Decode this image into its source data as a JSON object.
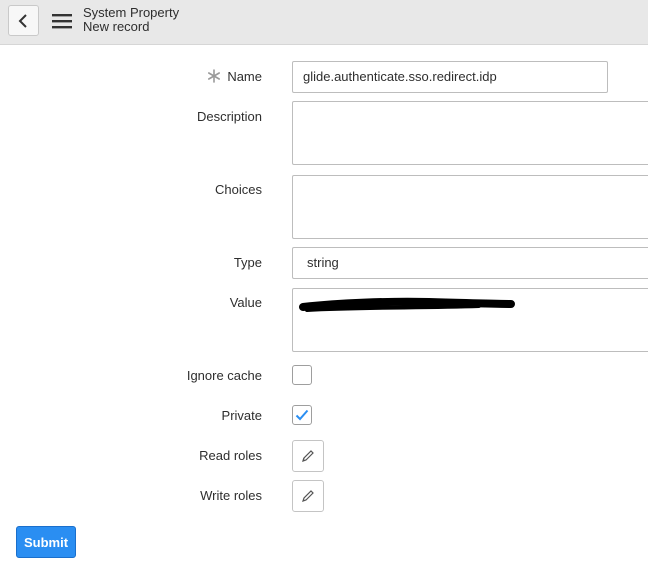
{
  "header": {
    "title": "System Property",
    "subtitle": "New record",
    "back_icon": "chevron-left-icon",
    "menu_icon": "hamburger-menu-icon"
  },
  "form": {
    "name": {
      "label": "Name",
      "value": "glide.authenticate.sso.redirect.idp",
      "mandatory": true
    },
    "description": {
      "label": "Description",
      "value": ""
    },
    "choices": {
      "label": "Choices",
      "value": ""
    },
    "type": {
      "label": "Type",
      "value": "string"
    },
    "value": {
      "label": "Value",
      "value": "",
      "redacted": true
    },
    "ignore_cache": {
      "label": "Ignore cache",
      "checked": false
    },
    "private": {
      "label": "Private",
      "checked": true
    },
    "read_roles": {
      "label": "Read roles",
      "icon": "pencil-icon"
    },
    "write_roles": {
      "label": "Write roles",
      "icon": "pencil-icon"
    }
  },
  "submit_label": "Submit",
  "colors": {
    "accent": "#2a8ef2",
    "check": "#2a8ef2",
    "header_bg": "#e8e8e8"
  }
}
